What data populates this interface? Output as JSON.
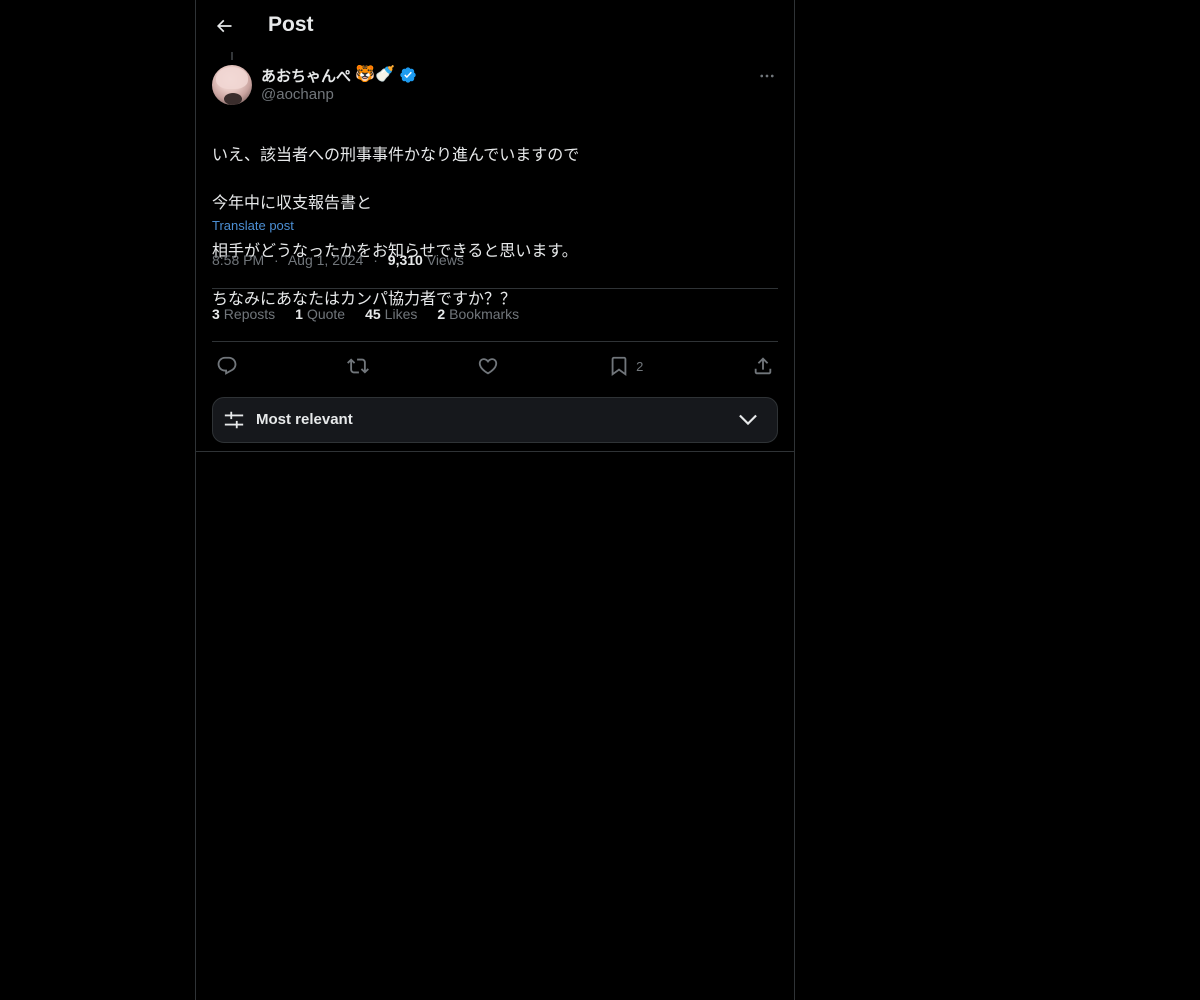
{
  "header": {
    "title": "Post",
    "back_icon": "arrow-left-icon"
  },
  "post": {
    "author": {
      "display_name": "あおちゃんぺ",
      "name_emojis": "🐯🍼",
      "handle": "@aochanp",
      "verified": true,
      "verified_color": "#1d9bf0"
    },
    "text_lines": [
      "いえ、該当者への刑事事件かなり進んでいますので",
      "今年中に収支報告書と",
      "相手がどうなったかをお知らせできると思います。",
      "ちなみにあなたはカンパ協力者ですか？？"
    ],
    "translate_label": "Translate post",
    "time": "8:58 PM",
    "date": "Aug 1, 2024",
    "views_count": "9,310",
    "views_label": "Views",
    "separator": "·"
  },
  "stats": {
    "reposts_count": "3",
    "reposts_label": "Reposts",
    "quotes_count": "1",
    "quotes_label": "Quote",
    "likes_count": "45",
    "likes_label": "Likes",
    "bookmarks_count": "2",
    "bookmarks_label": "Bookmarks"
  },
  "actions": {
    "reply_icon": "reply-icon",
    "repost_icon": "repost-icon",
    "like_icon": "heart-icon",
    "bookmark_icon": "bookmark-icon",
    "bookmark_count": "2",
    "share_icon": "share-icon"
  },
  "sort": {
    "label": "Most relevant",
    "icon": "sliders-icon",
    "chevron": "chevron-down-icon"
  },
  "colors": {
    "background": "#000000",
    "text_primary": "#e7e9ea",
    "text_secondary": "#71767b",
    "link": "#4c8fd4",
    "border": "#2f3336"
  }
}
